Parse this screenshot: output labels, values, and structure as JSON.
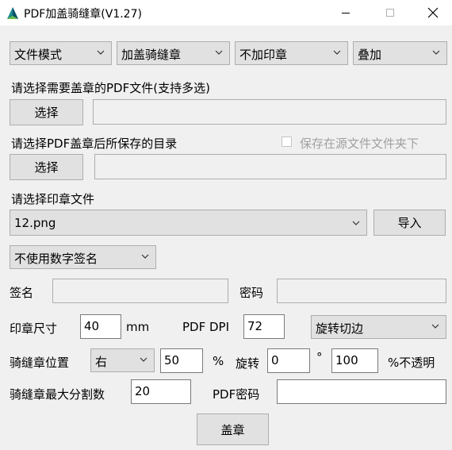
{
  "window": {
    "title": "PDF加盖骑缝章(V1.27)"
  },
  "top_combos": {
    "mode": "文件模式",
    "stamp_type": "加盖骑缝章",
    "seal_option": "不加印章",
    "overlay": "叠加"
  },
  "pdf_select": {
    "label": "请选择需要盖章的PDF文件(支持多选)",
    "button": "选择",
    "value": ""
  },
  "output_select": {
    "label": "请选择PDF盖章后所保存的目录",
    "keep_source_label": "保存在源文件文件夹下",
    "button": "选择",
    "value": ""
  },
  "seal_file": {
    "label": "请选择印章文件",
    "selected": "12.png",
    "import_button": "导入"
  },
  "digital_sig": {
    "selected": "不使用数字签名"
  },
  "signature": {
    "sign_label": "签名",
    "sign_value": "",
    "password_label": "密码",
    "password_value": ""
  },
  "seal_size": {
    "label": "印章尺寸",
    "value": "40",
    "unit": "mm",
    "dpi_label": "PDF DPI",
    "dpi_value": "72",
    "rotate_mode": "旋转切边"
  },
  "seam_pos": {
    "label": "骑缝章位置",
    "position": "右",
    "percent_value": "50",
    "percent_unit": "%",
    "rotate_label": "旋转",
    "rotate_value": "0",
    "degree_unit": "°",
    "opacity_value": "100",
    "opacity_unit": "%不透明"
  },
  "max_split": {
    "label": "骑缝章最大分割数",
    "value": "20",
    "pdf_pwd_label": "PDF密码",
    "pdf_pwd_value": ""
  },
  "stamp_button": {
    "label": "盖章"
  }
}
